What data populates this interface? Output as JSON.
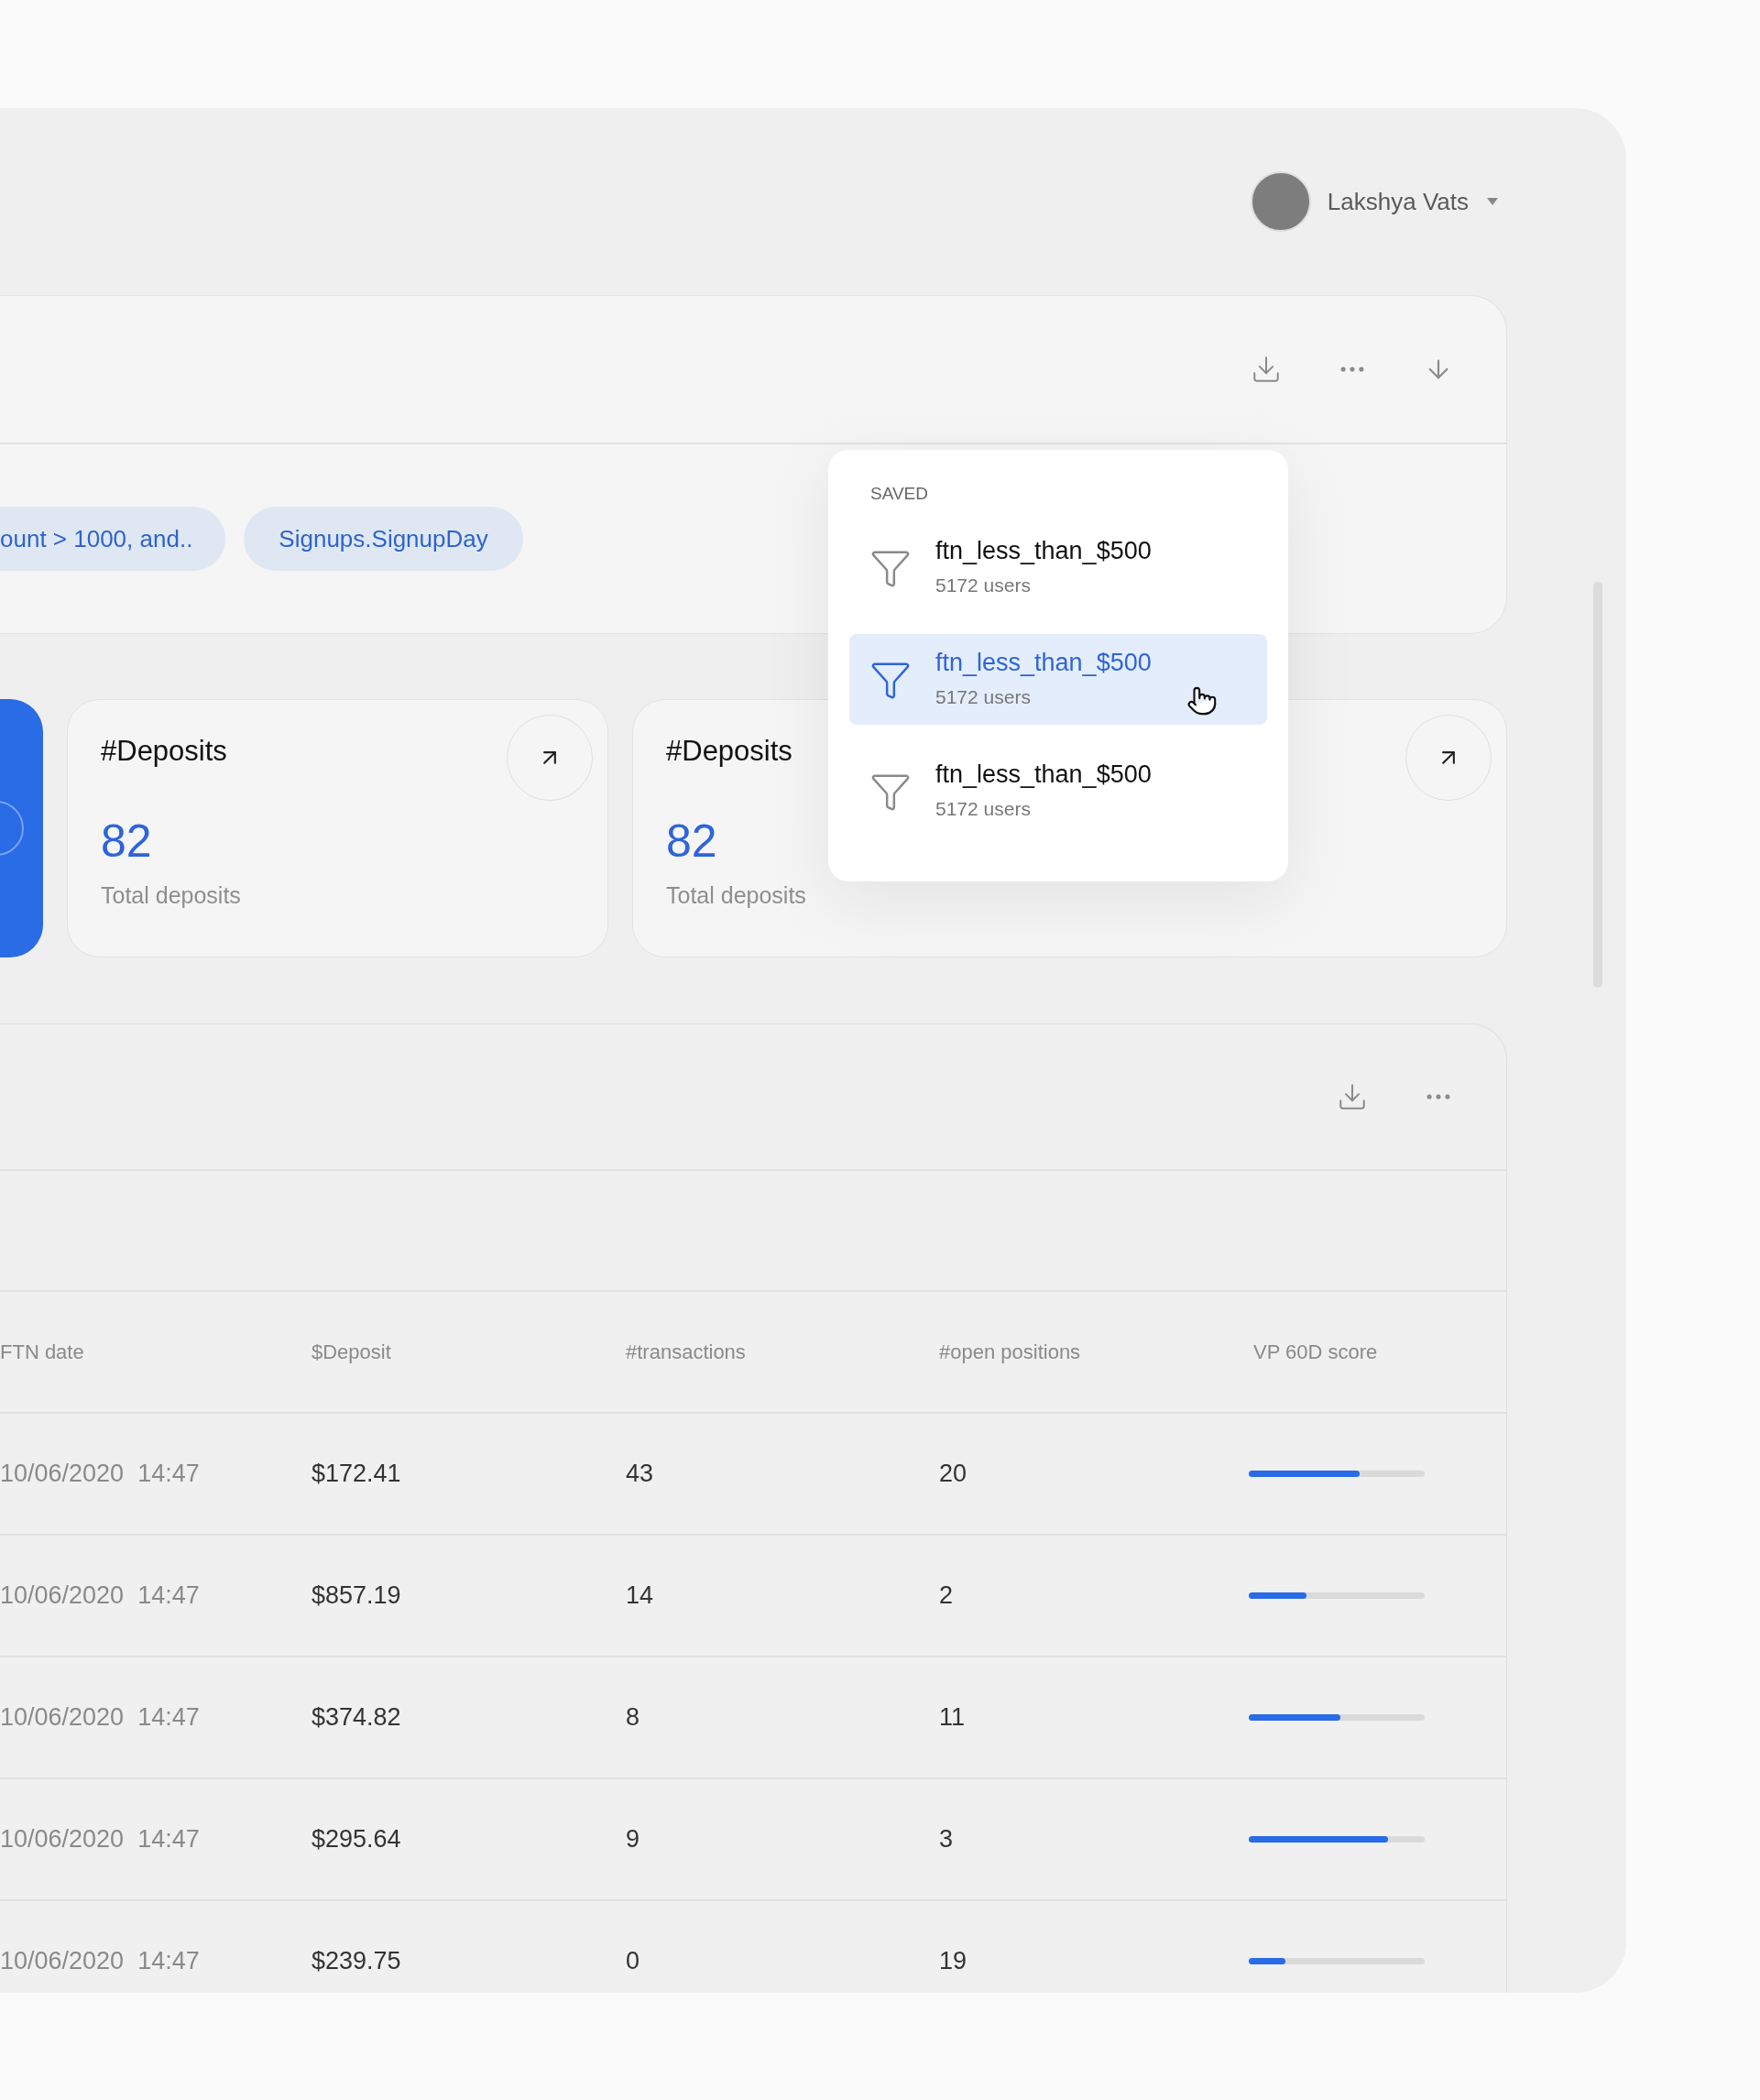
{
  "user": {
    "name": "Lakshya Vats"
  },
  "filters": [
    "ount > 1000, and..",
    "Signups.SignupDay"
  ],
  "stat_cards": [
    {
      "title": "#Deposits",
      "value": "82",
      "caption": "Total deposits"
    },
    {
      "title": "#Deposits",
      "value": "82",
      "caption": "Total deposits"
    }
  ],
  "saved_menu": {
    "heading": "SAVED",
    "items": [
      {
        "name": "ftn_less_than_$500",
        "count": "5172 users",
        "selected": false
      },
      {
        "name": "ftn_less_than_$500",
        "count": "5172 users",
        "selected": true
      },
      {
        "name": "ftn_less_than_$500",
        "count": "5172 users",
        "selected": false
      }
    ]
  },
  "table": {
    "columns": [
      "FTN date",
      "$Deposit",
      "#transactions",
      "#open positions",
      "VP 60D score"
    ],
    "rows": [
      {
        "ftn_date": "10/06/2020  14:47",
        "deposit": "$172.41",
        "transactions": "43",
        "open_positions": "20",
        "level": 0.63
      },
      {
        "ftn_date": "10/06/2020  14:47",
        "deposit": "$857.19",
        "transactions": "14",
        "open_positions": "2",
        "level": 0.33
      },
      {
        "ftn_date": "10/06/2020  14:47",
        "deposit": "$374.82",
        "transactions": "8",
        "open_positions": "11",
        "level": 0.52
      },
      {
        "ftn_date": "10/06/2020  14:47",
        "deposit": "$295.64",
        "transactions": "9",
        "open_positions": "3",
        "level": 0.79
      },
      {
        "ftn_date": "10/06/2020  14:47",
        "deposit": "$239.75",
        "transactions": "0",
        "open_positions": "19",
        "level": 0.21
      }
    ]
  }
}
